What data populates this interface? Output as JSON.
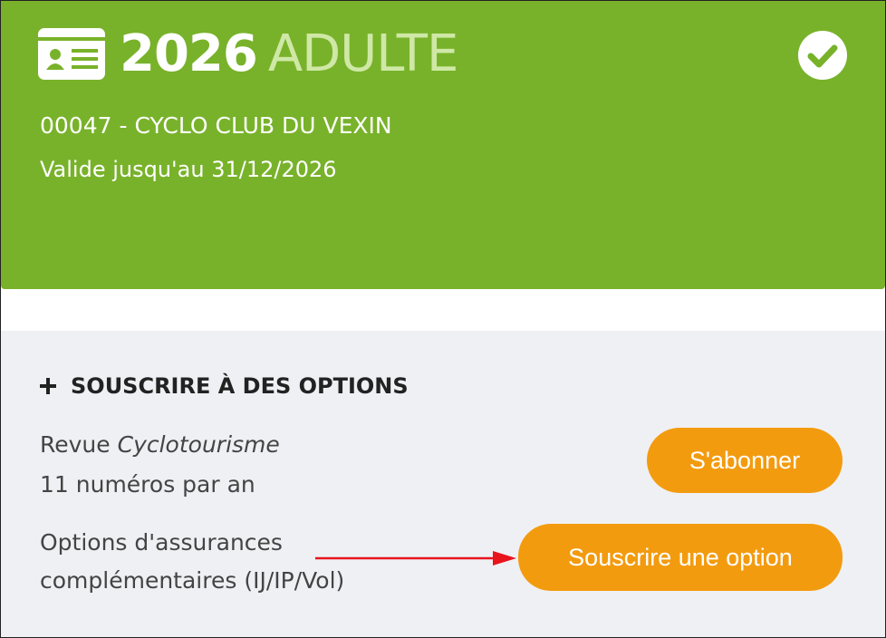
{
  "license": {
    "year": "2026",
    "type": "ADULTE",
    "club": "00047 - CYCLO CLUB DU VEXIN",
    "validity": "Valide jusqu'au 31/12/2026",
    "icon": "id-card-icon",
    "status_icon": "check-circle-icon"
  },
  "options": {
    "title": "SOUSCRIRE À DES OPTIONS",
    "magazine": {
      "prefix": "Revue ",
      "name": "Cyclotourisme",
      "frequency": "11 numéros par an",
      "button_label": "S'abonner"
    },
    "insurance": {
      "line1": "Options d'assurances",
      "line2": "complémentaires (IJ/IP/Vol)",
      "button_label": "Souscrire une option"
    }
  },
  "colors": {
    "header_green": "#78b22a",
    "accent_orange": "#f39b0f",
    "panel_grey": "#eff0f4",
    "arrow_red": "#e8141c"
  }
}
